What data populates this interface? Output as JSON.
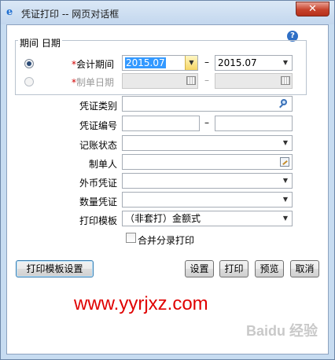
{
  "window": {
    "title": "凭证打印 -- 网页对话框",
    "close_label": "✕"
  },
  "period_group": {
    "legend": "期间 日期",
    "accounting_period": {
      "label": "会计期间",
      "required_mark": "*",
      "from_value": "2015.07",
      "to_value": "2015.07",
      "selected": true
    },
    "voucher_date": {
      "label": "制单日期",
      "required_mark": "*",
      "selected": false,
      "enabled": false
    },
    "separator": "–"
  },
  "fields": {
    "voucher_type": {
      "label": "凭证类别",
      "value": ""
    },
    "voucher_number": {
      "label": "凭证编号",
      "from_value": "",
      "to_value": "",
      "separator": "–"
    },
    "posting_status": {
      "label": "记账状态",
      "value": ""
    },
    "preparer": {
      "label": "制单人",
      "value": ""
    },
    "foreign_currency": {
      "label": "外币凭证",
      "value": ""
    },
    "quantity_voucher": {
      "label": "数量凭证",
      "value": ""
    },
    "print_template": {
      "label": "打印模板",
      "value": "（非套打）金额式"
    }
  },
  "merge_print": {
    "label": "合并分录打印",
    "checked": false
  },
  "buttons": {
    "template_settings": "打印模板设置",
    "settings": "设置",
    "print": "打印",
    "preview": "预览",
    "cancel": "取消"
  },
  "watermark": {
    "url_text": "www.yyrjxz.com",
    "brand_text": "Baidu 经验"
  },
  "colors": {
    "accent": "#3399ff",
    "watermark": "#e00000",
    "required": "#d00000",
    "frame": "#c7dcf1"
  }
}
